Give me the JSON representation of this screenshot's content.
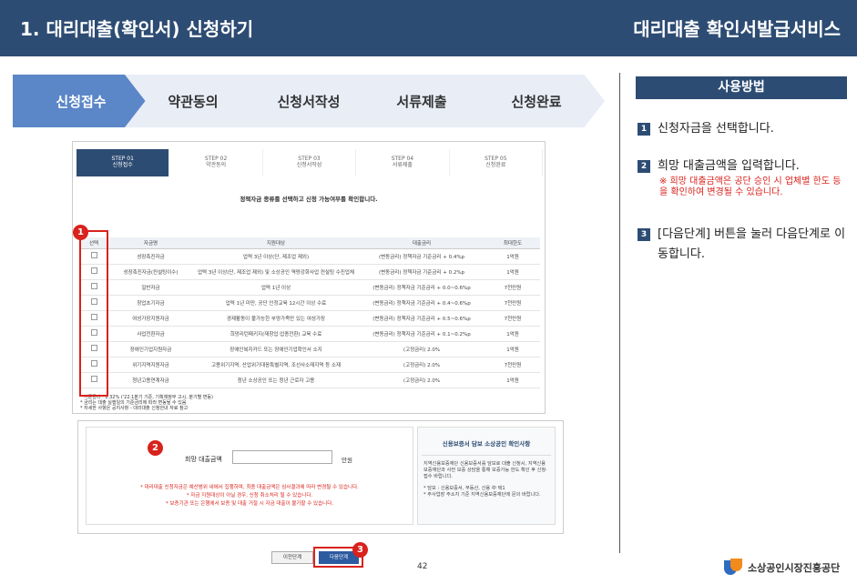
{
  "header": {
    "title": "1. 대리대출(확인서) 신청하기",
    "right_title": "대리대출 확인서발급서비스"
  },
  "steps": [
    "신청접수",
    "약관동의",
    "신청서작성",
    "서류제출",
    "신청완료"
  ],
  "doc": {
    "steps": [
      {
        "step": "STEP 01",
        "label": "신청접수"
      },
      {
        "step": "STEP 02",
        "label": "약관동의"
      },
      {
        "step": "STEP 03",
        "label": "신청서작성"
      },
      {
        "step": "STEP 04",
        "label": "서류제출"
      },
      {
        "step": "STEP 05",
        "label": "신청완료"
      }
    ],
    "instruction": "정책자금 종류를 선택하고 신청 가능여부를 확인합니다.",
    "table": {
      "headers": [
        "선택",
        "자금명",
        "지원대상",
        "대출금리",
        "최대한도"
      ],
      "rows": [
        [
          "성장촉진자금",
          "업력 3년 이상(단, 제조업 제외)",
          "(변동금리) 정책자금 기준금리 + 0.4%p",
          "1억원"
        ],
        [
          "성장촉진자금(컨설팅이수)",
          "업력 3년 이상(단, 제조업 제외) 및 소상공인 역량강화사업 컨설팅 수진업체",
          "(변동금리) 정책자금 기준금리 + 0.2%p",
          "1억원"
        ],
        [
          "일반자금",
          "업력 1년 이상",
          "(변동금리) 정책자금 기준금리 + 0.0~0.6%p",
          "7천만원"
        ],
        [
          "창업초기자금",
          "업력 1년 미만, 공단 인정교육 12시간 이상 수료",
          "(변동금리) 정책자금 기준금리 + 0.4~0.6%p",
          "7천만원"
        ],
        [
          "여성가장지원자금",
          "경제활동이 불가능한 부양가족만 있는 여성가장",
          "(변동금리) 정책자금 기준금리 + 0.5~0.6%p",
          "7천만원"
        ],
        [
          "사업전환자금",
          "희망리턴패키지(재창업·업종전환) 교육 수료",
          "(변동금리) 정책자금 기준금리 + 0.1~0.2%p",
          "1억원"
        ],
        [
          "장애인기업지원자금",
          "장애인복지카드 또는 장애인기업확인서 소지",
          "(고정금리) 2.0%",
          "1억원"
        ],
        [
          "위기지역지원자금",
          "고용위기지역, 산업위기대응특별지역, 조선사소재지역 등 소재",
          "(고정금리) 2.0%",
          "7천만원"
        ],
        [
          "청년고용연계자금",
          "청년 소상공인 또는 청년 근로자 고용",
          "(고정금리) 2.0%",
          "1억원"
        ]
      ]
    },
    "footnotes": [
      "* 기준금리 : 2.32% ('22.1분기 기준, 기획재정부 고시, 분기별 변동)",
      "* 금리는 대출 실행일의 기준금리에 따라 변동될 수 있음",
      "* 자세한 사항은 공지사항 - 대리대출 신청안내 자료 참고"
    ]
  },
  "form": {
    "amount_label": "희망 대출금액",
    "amount_value": "",
    "unit": "만원",
    "notes": [
      "* 대리대출 신청자금은 예산범위 내에서 집행하며, 최종 대출금액은 심사결과에 따라 변경될 수 있습니다.",
      "* 자금 지원대상이 아닐 경우, 신청 취소처리 될 수 있습니다.",
      "* 보증기관 또는 은행에서 보증 및 대출 거절 시 자금 대출이 불가할 수 있습니다."
    ],
    "side_title": "신용보증서 담보 소상공인 확인사항",
    "side_text": [
      "지역신용보증재단 신용보증서를 담보로 대출 신청시, 지역신용보증재단과 사전 보증 상담을 통해 보증가능 한도 확인 후 신청·접수 바랍니다.",
      "* 담보 : 신용보증서, 부동산, 신용 中 택1",
      "* 주사업장 주소지 기준 지역신용보증재단에 문의 바랍니다."
    ],
    "prev_button": "이전단계",
    "next_button": "다음단계"
  },
  "page_number": "42",
  "badges": [
    "1",
    "2",
    "3"
  ],
  "usage": {
    "title": "사용방법",
    "items": [
      {
        "num": "1",
        "text": "신청자금을 선택합니다."
      },
      {
        "num": "2",
        "text": "희망 대출금액을 입력합니다."
      },
      {
        "num": "3",
        "text": "[다음단계] 버튼을 눌러 다음단계로 이동합니다."
      }
    ],
    "warning": "※ 희망 대출금액은 공단 승인 시 업체별 한도 등을 확인하여 변경될 수 있습니다."
  },
  "footer": {
    "org": "소상공인시장진흥공단"
  },
  "colors": {
    "navy": "#2d4c73",
    "accent": "#5b86c7",
    "red": "#d9221c"
  }
}
